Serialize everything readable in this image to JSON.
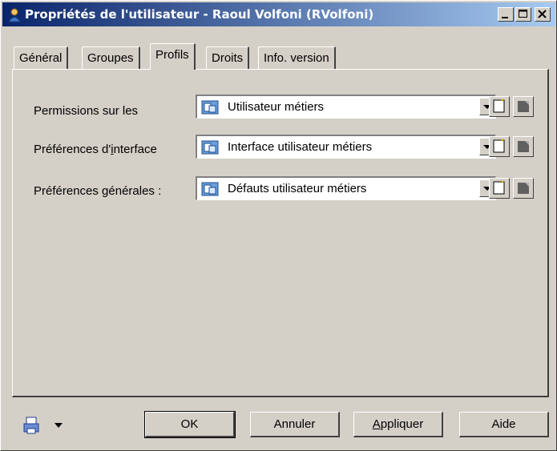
{
  "window": {
    "title": "Propriétés de l'utilisateur - Raoul Volfoni (RVolfoni)"
  },
  "tabs": [
    {
      "label": "Général"
    },
    {
      "label": "Groupes"
    },
    {
      "label": "Profils"
    },
    {
      "label": "Droits"
    },
    {
      "label": "Info. version"
    }
  ],
  "active_tab": "Profils",
  "form": {
    "permissions": {
      "label": "Permissions sur les",
      "value": "Utilisateur métiers"
    },
    "interface": {
      "label_pre": "Préférences d'",
      "label_u": "i",
      "label_post": "nterface",
      "value": "Interface utilisateur métiers"
    },
    "generales": {
      "label_pre": "Préférences ",
      "label_u": "g",
      "label_post": "énérales :",
      "value": "Défauts utilisateur métiers"
    }
  },
  "buttons": {
    "ok": "OK",
    "cancel": "Annuler",
    "apply_u": "A",
    "apply_rest": "ppliquer",
    "help": "Aide"
  },
  "icons": {
    "title": "user-icon",
    "combo": "profile-icon",
    "new": "new-document-icon",
    "properties": "properties-icon",
    "print": "print-menu-icon"
  },
  "colors": {
    "titlebar_start": "#0a246a",
    "titlebar_end": "#a6caf0",
    "face": "#d4d0c8"
  }
}
